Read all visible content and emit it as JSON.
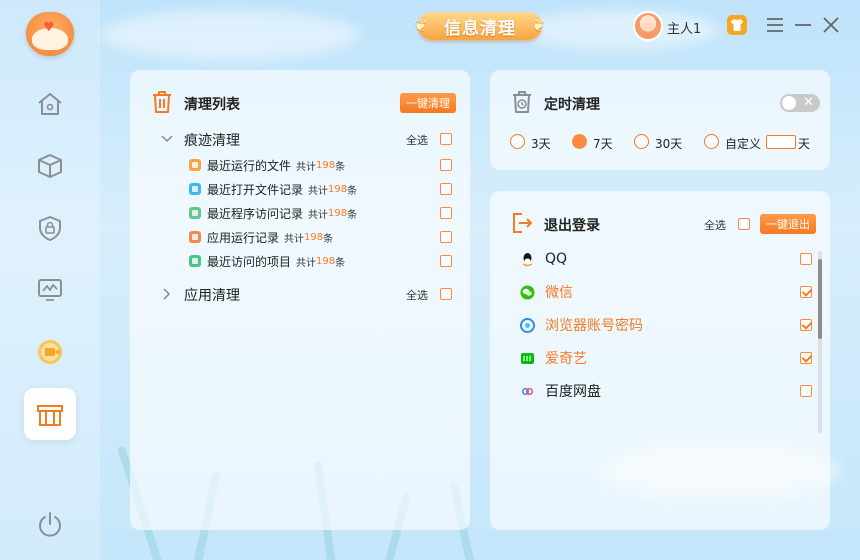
{
  "header": {
    "title": "信息清理",
    "user_name": "主人1"
  },
  "sidebar": {
    "items": [
      {
        "name": "home"
      },
      {
        "name": "cube"
      },
      {
        "name": "lock"
      },
      {
        "name": "monitor"
      },
      {
        "name": "plugin"
      },
      {
        "name": "cleanup",
        "active": true
      },
      {
        "name": "power"
      }
    ]
  },
  "clean_list": {
    "title": "清理列表",
    "one_click": "一键清理",
    "trace_group": {
      "label": "痕迹清理",
      "select_all": "全选",
      "items": [
        {
          "name": "最近运行的文件",
          "total_prefix": "共计",
          "count": "198",
          "unit": "条",
          "color": "#f7a441"
        },
        {
          "name": "最近打开文件记录",
          "total_prefix": "共计",
          "count": "198",
          "unit": "条",
          "color": "#3fb8f0"
        },
        {
          "name": "最近程序访问记录",
          "total_prefix": "共计",
          "count": "198",
          "unit": "条",
          "color": "#62c98a"
        },
        {
          "name": "应用运行记录",
          "total_prefix": "共计",
          "count": "198",
          "unit": "条",
          "color": "#f5874f"
        },
        {
          "name": "最近访问的项目",
          "total_prefix": "共计",
          "count": "198",
          "unit": "条",
          "color": "#4cc38a"
        }
      ]
    },
    "app_group": {
      "label": "应用清理",
      "select_all": "全选"
    }
  },
  "timed_clean": {
    "title": "定时清理",
    "options": [
      {
        "label": "3天",
        "selected": false
      },
      {
        "label": "7天",
        "selected": true
      },
      {
        "label": "30天",
        "selected": false
      },
      {
        "label": "自定义",
        "selected": false
      }
    ],
    "custom_value": "",
    "custom_unit": "天",
    "toggle_on": false
  },
  "logout": {
    "title": "退出登录",
    "select_all": "全选",
    "one_click": "一键退出",
    "apps": [
      {
        "name": "QQ",
        "checked": false,
        "color": "#111111",
        "label_color": "#222222"
      },
      {
        "name": "微信",
        "checked": true,
        "color": "#2dc100",
        "label_color": "#f57a22"
      },
      {
        "name": "浏览器账号密码",
        "checked": true,
        "color": "#2a8ee8",
        "label_color": "#f57a22"
      },
      {
        "name": "爱奇艺",
        "checked": true,
        "color": "#00be06",
        "label_color": "#f57a22"
      },
      {
        "name": "百度网盘",
        "checked": false,
        "color": "#3b7df5",
        "label_color": "#222222"
      }
    ]
  },
  "colors": {
    "accent": "#f57a22",
    "sidebar_icon": "#8a8f96"
  }
}
